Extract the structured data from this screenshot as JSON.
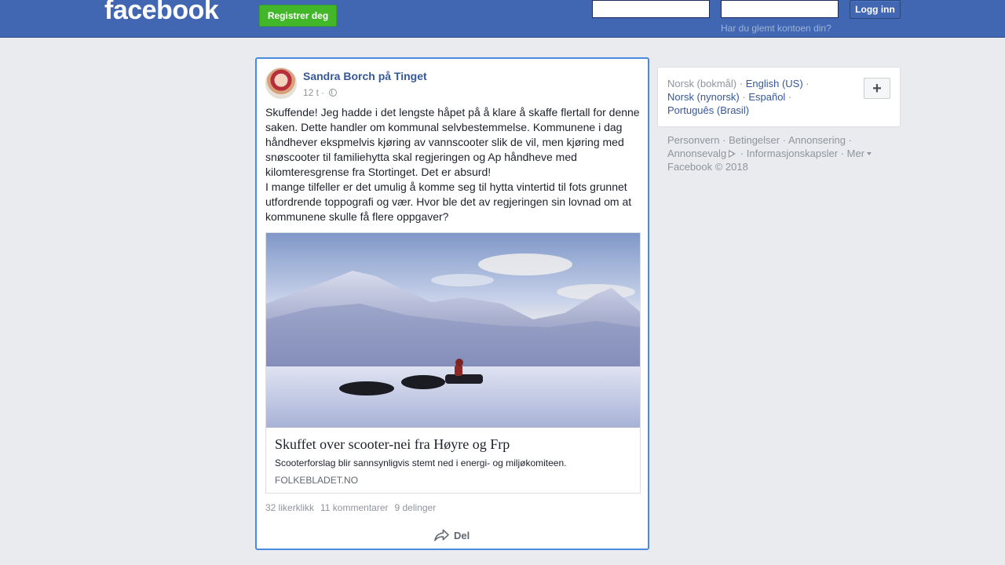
{
  "header": {
    "logo_text": "facebook",
    "register_label": "Registrer deg",
    "email_value": "",
    "password_value": "",
    "login_label": "Logg inn",
    "forgot_label": "Har du glemt kontoen din?",
    "brand_color": "#4267b2",
    "register_color": "#42b72a"
  },
  "post": {
    "author": "Sandra Borch på Tinget",
    "time": "12 t",
    "separator": "·",
    "privacy_icon": "globe-icon",
    "paragraphs": [
      "Skuffende! Jeg hadde i det lengste håpet på å klare å skaffe flertall for denne saken. Dette handler om kommunal selvbestemmelse. Kommunene i dag håndhever ekspmelvis kjøring av vannscooter slik de vil, men kjøring med snøscooter til familiehytta skal regjeringen og Ap håndheve med kilomteresgrense fra Stortinget. Det er absurd!",
      "I mange tilfeller er det umulig å komme seg til hytta vintertid til fots grunnet utfordrende toppografi og vær. Hvor ble det av regjeringen sin lovnad om at kommunene skulle få flere oppgaver?"
    ],
    "link": {
      "title": "Skuffet over scooter-nei fra Høyre og Frp",
      "description": "Scooterforslag blir sannsynligvis stemt ned i energi- og miljøkomiteen.",
      "domain": "FOLKEBLADET.NO"
    },
    "stats": {
      "likes": "32 likerklikk",
      "comments": "11 kommentarer",
      "shares": "9 delinger"
    },
    "share_label": "Del",
    "share_icon": "share-arrow-icon"
  },
  "sidebar": {
    "languages": [
      {
        "label": "Norsk (bokmål)",
        "current": true
      },
      {
        "label": "English (US)",
        "current": false
      },
      {
        "label": "Norsk (nynorsk)",
        "current": false
      },
      {
        "label": "Español",
        "current": false
      },
      {
        "label": "Português (Brasil)",
        "current": false
      }
    ],
    "more_languages_label": "+",
    "footer": {
      "privacy": "Personvern",
      "terms": "Betingelser",
      "advertising": "Annonsering",
      "adchoices": "Annonsevalg",
      "cookies": "Informasjonskapsler",
      "more": "Mer",
      "copyright": "Facebook © 2018"
    }
  }
}
